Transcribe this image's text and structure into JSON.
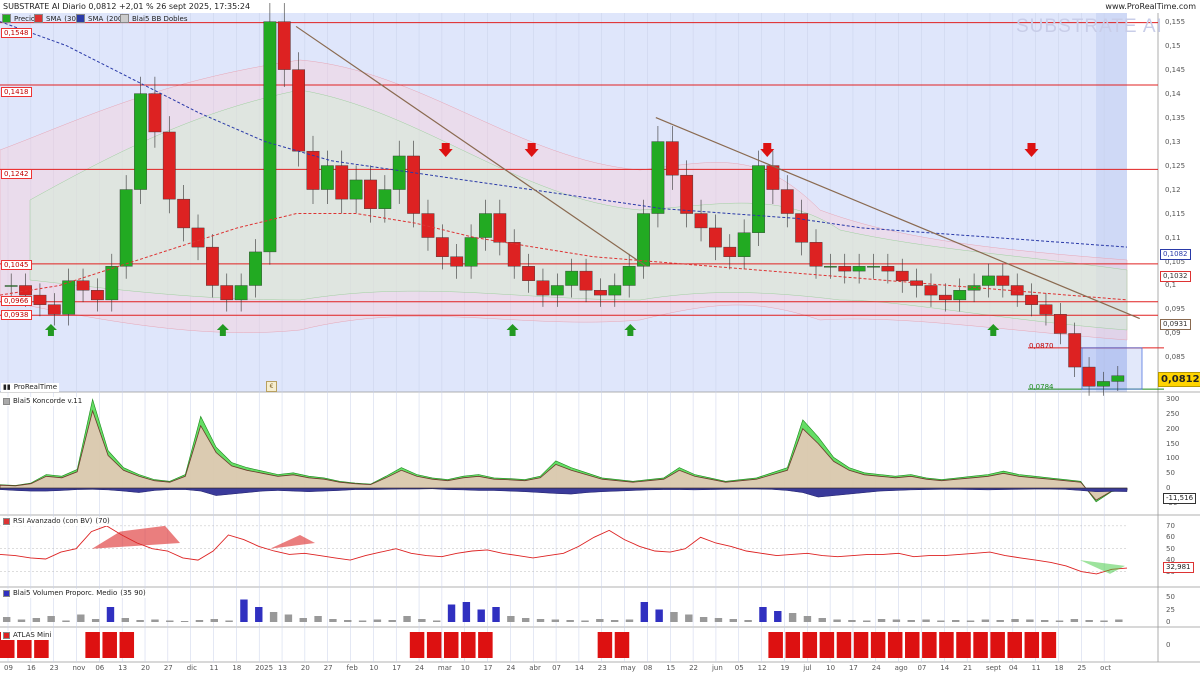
{
  "header": {
    "title": "SUBSTRATE AI Diario 0,0812 +2,01 % 26 sept 2025, 17:35:24",
    "site": "www.ProRealTime.com",
    "watermark": "SUBSTRATE AI",
    "brand": "ProRealTime"
  },
  "legend": [
    {
      "label": "Precio",
      "color": "#22aa22"
    },
    {
      "label": "SMA",
      "param": "(30)",
      "color": "#dd3333"
    },
    {
      "label": "SMA",
      "param": "(200)",
      "color": "#2a3aa8"
    },
    {
      "label": "Blai5 BB Dobles",
      "color": "#cccccc"
    }
  ],
  "levels": [
    {
      "label": "0,1548",
      "value": 0.1548
    },
    {
      "label": "0,1418",
      "value": 0.1418
    },
    {
      "label": "0,1242",
      "value": 0.1242
    },
    {
      "label": "0,1045",
      "value": 0.1045
    },
    {
      "label": "0,0966",
      "value": 0.0966
    },
    {
      "label": "0,0938",
      "value": 0.0938
    }
  ],
  "recent_levels": [
    {
      "label": "0,0870",
      "value": 0.087
    },
    {
      "label": "0,0784",
      "value": 0.0784
    }
  ],
  "price_axis": [
    "0,155",
    "0,15",
    "0,145",
    "0,14",
    "0,135",
    "0,13",
    "0,125",
    "0,12",
    "0,115",
    "0,11",
    "0,105",
    "0,1",
    "0,095",
    "0,09",
    "0,085",
    "0,08"
  ],
  "price_boxes": {
    "sma200": "0,1082",
    "sma30": "0,1032",
    "trend": "0,0931",
    "last": "0,0812"
  },
  "panels": {
    "koncorde": {
      "title": "Blai5 Koncorde v.11",
      "ticks": [
        "300",
        "250",
        "200",
        "150",
        "100",
        "50",
        "0",
        "-50"
      ],
      "value": "-11,516"
    },
    "rsi": {
      "title": "RSI Avanzado (con BV)",
      "param": "(70)",
      "ticks": [
        "70",
        "60",
        "50",
        "40",
        "30"
      ],
      "value": "32,981"
    },
    "volume": {
      "title": "Blai5 Volumen Proporc. Medio",
      "param": "(35 90)",
      "ticks": [
        "50",
        "25",
        "0"
      ]
    },
    "atlas": {
      "title": "ATLAS Mini",
      "ticks": [
        "0"
      ]
    }
  },
  "dates": [
    "09",
    "16",
    "23",
    "nov",
    "06",
    "13",
    "20",
    "27",
    "dic",
    "11",
    "18",
    "2025",
    "13",
    "20",
    "27",
    "feb",
    "10",
    "17",
    "24",
    "mar",
    "10",
    "17",
    "24",
    "abr",
    "07",
    "14",
    "23",
    "may",
    "08",
    "15",
    "22",
    "jun",
    "05",
    "12",
    "19",
    "jul",
    "10",
    "17",
    "24",
    "ago",
    "07",
    "14",
    "21",
    "sept",
    "04",
    "11",
    "18",
    "25",
    "oct"
  ],
  "colors": {
    "up": "#22aa22",
    "down": "#dd2222",
    "level": "#e02020",
    "trend": "#8a6a50",
    "bg": "#dfe6fb"
  },
  "chart_data": [
    {
      "type": "candlestick",
      "title": "SUBSTRATE AI Diario",
      "ylabel": "",
      "ylim": [
        0.0778,
        0.1568
      ],
      "x_start": "2024-10-07",
      "x_end": "2025-09-26",
      "series": [
        {
          "name": "SMA",
          "param": "30",
          "values": [
            0.098,
            0.1,
            0.104,
            0.108,
            0.112,
            0.115,
            0.115,
            0.113,
            0.11,
            0.108,
            0.106,
            0.105,
            0.104,
            0.103,
            0.102,
            0.101,
            0.1,
            0.099,
            0.098,
            0.097
          ]
        },
        {
          "name": "SMA",
          "param": "200",
          "values": [
            0.155,
            0.15,
            0.143,
            0.136,
            0.13,
            0.126,
            0.124,
            0.122,
            0.12,
            0.118,
            0.116,
            0.115,
            0.114,
            0.112,
            0.111,
            0.11,
            0.109,
            0.108
          ]
        }
      ],
      "closes": [
        0.1,
        0.098,
        0.096,
        0.094,
        0.101,
        0.099,
        0.097,
        0.104,
        0.12,
        0.14,
        0.132,
        0.118,
        0.112,
        0.108,
        0.1,
        0.097,
        0.1,
        0.107,
        0.155,
        0.145,
        0.128,
        0.12,
        0.125,
        0.118,
        0.122,
        0.116,
        0.12,
        0.127,
        0.115,
        0.11,
        0.106,
        0.104,
        0.11,
        0.115,
        0.109,
        0.104,
        0.101,
        0.098,
        0.1,
        0.103,
        0.099,
        0.098,
        0.1,
        0.104,
        0.115,
        0.13,
        0.123,
        0.115,
        0.112,
        0.108,
        0.106,
        0.111,
        0.125,
        0.12,
        0.115,
        0.109,
        0.104,
        0.104,
        0.103,
        0.104,
        0.104,
        0.103,
        0.101,
        0.1,
        0.098,
        0.097,
        0.099,
        0.1,
        0.102,
        0.1,
        0.098,
        0.096,
        0.094,
        0.09,
        0.083,
        0.079,
        0.08,
        0.0812
      ],
      "trendlines": [
        {
          "from": [
            "2025-01-08",
            0.154
          ],
          "to": [
            "2025-04-28",
            0.104
          ]
        },
        {
          "from": [
            "2025-05-01",
            0.135
          ],
          "to": [
            "2025-09-30",
            0.0931
          ]
        }
      ],
      "arrows_down": [
        "2025-02-24",
        "2025-03-23",
        "2025-06-05",
        "2025-08-27"
      ],
      "arrows_up": [
        "2024-10-23",
        "2024-12-16",
        "2025-03-17",
        "2025-04-23",
        "2025-08-15"
      ]
    },
    {
      "type": "area",
      "title": "Blai5 Koncorde v.11",
      "ylim": [
        -60,
        310
      ],
      "series": [
        {
          "name": "marrón",
          "values": [
            10,
            8,
            15,
            40,
            35,
            55,
            260,
            110,
            60,
            40,
            25,
            20,
            40,
            210,
            120,
            75,
            60,
            50,
            40,
            45,
            35,
            30,
            20,
            15,
            12,
            35,
            60,
            40,
            30,
            25,
            35,
            40,
            30,
            28,
            25,
            35,
            80,
            60,
            45,
            30,
            25,
            20,
            25,
            30,
            60,
            40,
            30,
            20,
            25,
            30,
            45,
            60,
            200,
            150,
            90,
            60,
            45,
            40,
            35,
            40,
            30,
            25,
            30,
            35,
            40,
            50,
            40,
            35,
            30,
            25,
            20,
            -40,
            -10,
            -5
          ]
        },
        {
          "name": "azul",
          "values": [
            -5,
            -8,
            -10,
            -10,
            -8,
            -5,
            -4,
            -6,
            -10,
            -15,
            -8,
            -5,
            -5,
            -10,
            -25,
            -20,
            -15,
            -10,
            -8,
            -10,
            -12,
            -10,
            -8,
            -5,
            -5,
            -4,
            -3,
            -3,
            -2,
            -5,
            -6,
            -8,
            -8,
            -10,
            -12,
            -15,
            -18,
            -20,
            -15,
            -12,
            -10,
            -8,
            -6,
            -5,
            -5,
            -6,
            -5,
            -4,
            -3,
            -3,
            -4,
            -8,
            -15,
            -30,
            -25,
            -20,
            -15,
            -10,
            -8,
            -6,
            -5,
            -4,
            -4,
            -5,
            -6,
            -5,
            -4,
            -3,
            -3,
            -4,
            -8,
            -12,
            -11,
            -11.5
          ]
        }
      ]
    },
    {
      "type": "line",
      "title": "RSI Avanzado (con BV)",
      "ylim": [
        20,
        76
      ],
      "values": [
        45,
        44,
        42,
        41,
        47,
        50,
        65,
        70,
        62,
        55,
        50,
        48,
        42,
        40,
        48,
        62,
        58,
        52,
        48,
        45,
        46,
        44,
        42,
        40,
        44,
        47,
        50,
        46,
        44,
        43,
        46,
        48,
        49,
        46,
        44,
        42,
        44,
        46,
        52,
        60,
        66,
        58,
        52,
        48,
        47,
        50,
        60,
        55,
        52,
        48,
        46,
        44,
        45,
        46,
        44,
        43,
        44,
        45,
        45,
        46,
        43,
        44,
        44,
        45,
        46,
        47,
        44,
        42,
        40,
        38,
        35,
        30,
        28,
        32,
        33
      ]
    },
    {
      "type": "bar",
      "title": "Blai5 Volumen Proporc. Medio",
      "ylim": [
        -10,
        60
      ],
      "values": [
        10,
        5,
        8,
        12,
        3,
        15,
        6,
        30,
        8,
        4,
        5,
        3,
        2,
        4,
        6,
        3,
        45,
        30,
        20,
        15,
        8,
        12,
        6,
        4,
        3,
        5,
        4,
        12,
        6,
        3,
        35,
        40,
        25,
        30,
        12,
        8,
        6,
        5,
        4,
        3,
        6,
        4,
        5,
        40,
        25,
        20,
        15,
        10,
        8,
        6,
        4,
        30,
        22,
        18,
        12,
        8,
        5,
        4,
        3,
        6,
        5,
        4,
        5,
        3,
        4,
        3,
        5,
        4,
        6,
        5,
        4,
        3,
        6,
        4,
        3,
        5
      ]
    },
    {
      "type": "bar",
      "title": "ATLAS Mini",
      "values": [
        1,
        1,
        1,
        0,
        0,
        1,
        1,
        1,
        0,
        0,
        0,
        0,
        0,
        0,
        0,
        0,
        0,
        0,
        0,
        0,
        0,
        0,
        0,
        0,
        1,
        1,
        1,
        1,
        1,
        0,
        0,
        0,
        0,
        0,
        0,
        1,
        1,
        0,
        0,
        0,
        0,
        0,
        0,
        0,
        0,
        1,
        1,
        1,
        1,
        1,
        1,
        1,
        1,
        1,
        1,
        1,
        1,
        1,
        1,
        1,
        1,
        1,
        0,
        0,
        0,
        0
      ]
    }
  ]
}
